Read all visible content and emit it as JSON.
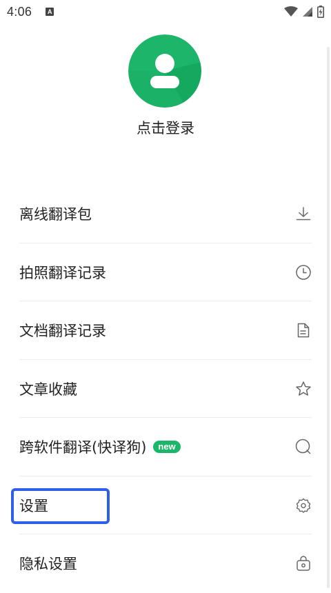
{
  "status_bar": {
    "time": "4:06",
    "notification_icon_letter": "A",
    "icons": [
      "wifi-icon",
      "cell-signal-icon",
      "battery-icon"
    ]
  },
  "profile": {
    "avatar_icon": "user-avatar-icon",
    "login_label": "点击登录",
    "accent_color": "#1db56a"
  },
  "menu": {
    "items": [
      {
        "label": "离线翻译包",
        "icon": "download-icon"
      },
      {
        "label": "拍照翻译记录",
        "icon": "clock-icon"
      },
      {
        "label": "文档翻译记录",
        "icon": "document-icon"
      },
      {
        "label": "文章收藏",
        "icon": "star-icon"
      },
      {
        "label": "跨软件翻译(快译狗)",
        "icon": "search-circle-icon",
        "badge": "new"
      },
      {
        "label": "设置",
        "icon": "gear-icon"
      },
      {
        "label": "隐私设置",
        "icon": "privacy-lock-icon"
      }
    ]
  },
  "highlight": {
    "target": "设置",
    "color": "#2f5fe6"
  }
}
